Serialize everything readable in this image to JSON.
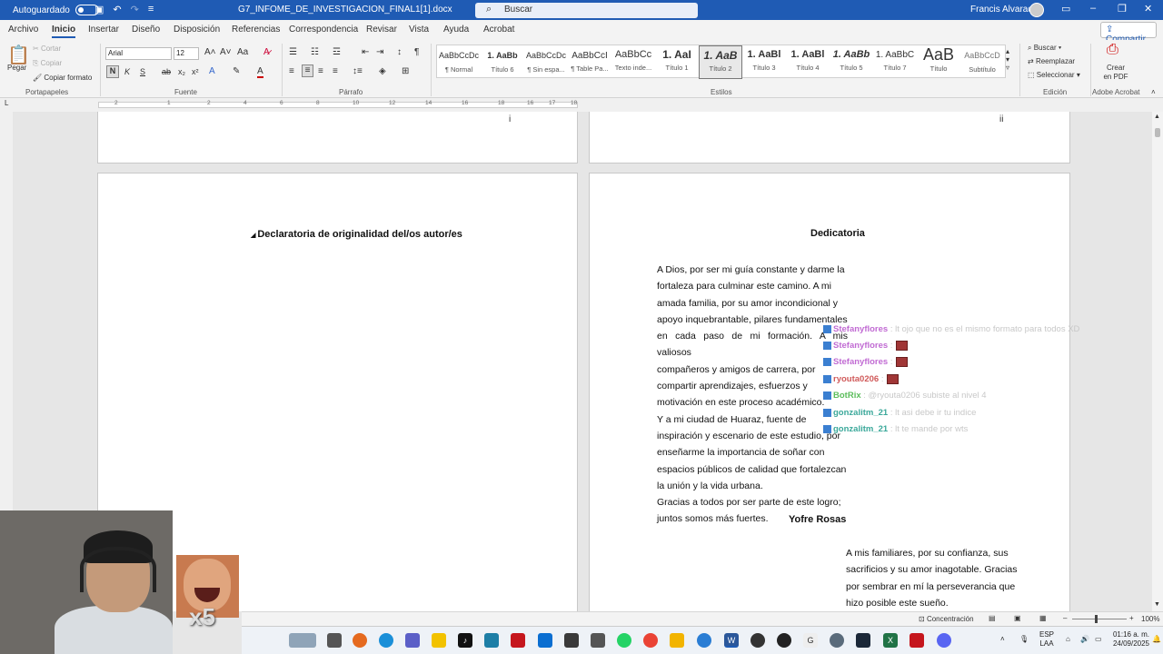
{
  "titlebar": {
    "autosave_label": "Autoguardado",
    "doc_title": "G7_INFOME_DE_INVESTIGACION_FINAL1[1].docx",
    "search_placeholder": "Buscar",
    "user_name": "Francis Alvarado"
  },
  "menu": {
    "tabs": [
      "Archivo",
      "Inicio",
      "Insertar",
      "Diseño",
      "Disposición",
      "Referencias",
      "Correspondencia",
      "Revisar",
      "Vista",
      "Ayuda",
      "Acrobat"
    ],
    "active_tab": "Inicio",
    "share_label": "Compartir"
  },
  "ribbon": {
    "clipboard": {
      "paste": "Pegar",
      "cut": "Cortar",
      "copy": "Copiar",
      "format_painter": "Copiar formato",
      "label": "Portapapeles"
    },
    "font": {
      "name": "Arial",
      "size": "12",
      "label": "Fuente",
      "bold": "N",
      "italic": "K",
      "underline": "S"
    },
    "paragraph": {
      "label": "Párrafo"
    },
    "styles": {
      "label": "Estilos",
      "items": [
        {
          "preview": "AaBbCcDc",
          "name": "¶ Normal"
        },
        {
          "preview": "1. AaBb",
          "name": "Título 6"
        },
        {
          "preview": "AaBbCcDc",
          "name": "¶ Sin espa..."
        },
        {
          "preview": "AaBbCcI",
          "name": "¶ Table Pa..."
        },
        {
          "preview": "AaBbCc",
          "name": "Texto inde..."
        },
        {
          "preview": "1. AaI",
          "name": "Título 1"
        },
        {
          "preview": "1. AaB",
          "name": "Título 2"
        },
        {
          "preview": "1. AaBl",
          "name": "Título 3"
        },
        {
          "preview": "1. AaBl",
          "name": "Título 4"
        },
        {
          "preview": "1. AaBb",
          "name": "Título 5"
        },
        {
          "preview": "1. AaBbC",
          "name": "Título 7"
        },
        {
          "preview": "AaB",
          "name": "Título"
        },
        {
          "preview": "AaBbCcD",
          "name": "Subtítulo"
        }
      ],
      "selected_index": 6
    },
    "editing": {
      "find": "Buscar",
      "replace": "Reemplazar",
      "select": "Seleccionar",
      "label": "Edición"
    },
    "acrobat": {
      "create_pdf": "Crear en PDF",
      "label": "Adobe Acrobat"
    }
  },
  "document": {
    "page_num_left": "i",
    "page_num_right": "ii",
    "left_heading": "Declaratoria de originalidad del/os autor/es",
    "right_heading": "Dedicatoria",
    "dedication_lines": [
      "A Dios, por ser mi guía constante y darme la",
      "fortaleza para culminar este camino. A mi",
      "amada familia, por su amor incondicional y",
      "apoyo inquebrantable, pilares fundamentales",
      "en cada paso de mi formación. A mis valiosos",
      "compañeros y amigos de carrera, por",
      "compartir aprendizajes, esfuerzos y",
      "motivación en este proceso académico.",
      "Y a mi ciudad de Huaraz, fuente de",
      "inspiración y escenario de este estudio, por",
      "enseñarme la importancia de soñar con",
      "espacios públicos de calidad que fortalezcan",
      "la unión y la vida urbana.",
      "Gracias a todos por ser parte de este logro;",
      "juntos somos más fuertes."
    ],
    "signature": "Yofre Rosas",
    "second_dedication_lines": [
      "A mis familiares, por su confianza, sus",
      "sacrificios y su amor inagotable. Gracias",
      "por sembrar en mí la perseverancia que",
      "hizo posible este sueño."
    ]
  },
  "chat": [
    {
      "user": "Stefanyflores",
      "msg": ": lt ojo que no es el mismo formato para todos XD",
      "color": "#c16bd3"
    },
    {
      "user": "Stefanyflores",
      "msg": ":",
      "color": "#c16bd3"
    },
    {
      "user": "Stefanyflores",
      "msg": ":",
      "color": "#c16bd3"
    },
    {
      "user": "ryouta0206",
      "msg": ":",
      "color": "#d05a5a"
    },
    {
      "user": "BotRix",
      "msg": ": @ryouta0206 subiste al nivel 4",
      "color": "#5bbd5b"
    },
    {
      "user": "gonzalitm_21",
      "msg": ": lt asi debe ir tu indice",
      "color": "#3aa89a"
    },
    {
      "user": "gonzalitm_21",
      "msg": ": lt te mande por wts",
      "color": "#3aa89a"
    }
  ],
  "overlay": {
    "multiplier": "x5"
  },
  "statusbar": {
    "focus": "Concentración",
    "zoom": "100%"
  },
  "taskbar": {
    "lang": "ESP",
    "lang2": "LAA",
    "time": "01:16 a. m.",
    "date": "24/09/2025"
  }
}
